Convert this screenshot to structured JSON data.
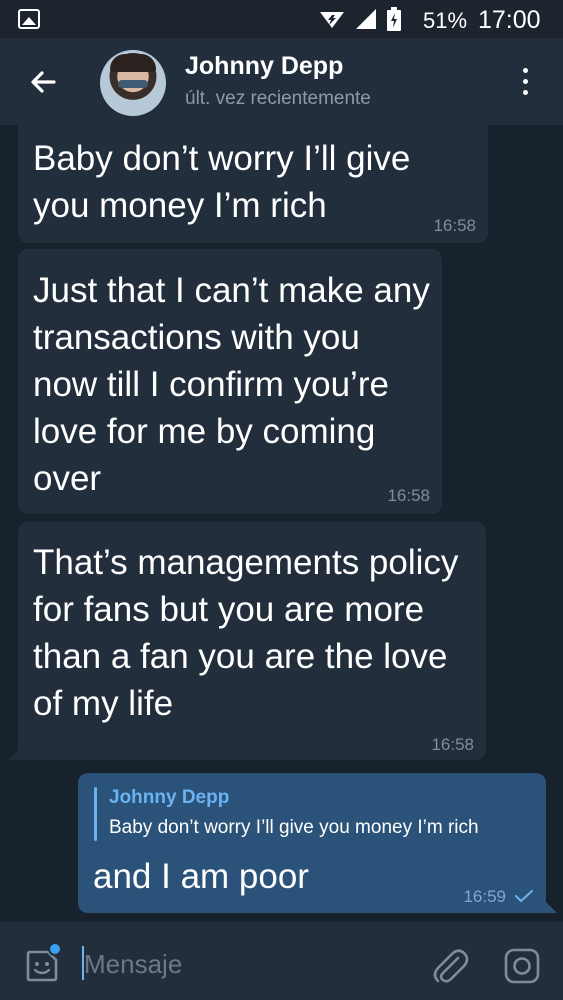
{
  "status_bar": {
    "battery_pct": "51%",
    "time": "17:00"
  },
  "header": {
    "contact_name": "Johnny Depp",
    "last_seen": "últ. vez recientemente"
  },
  "messages": [
    {
      "direction": "incoming",
      "text": "Baby don’t worry I’ll give you money I’m rich",
      "time": "16:58"
    },
    {
      "direction": "incoming",
      "text": "Just that I can’t make any transactions with you now till I confirm you’re love for me by coming over",
      "time": "16:58"
    },
    {
      "direction": "incoming",
      "text": "That’s managements policy for fans but you are more than a fan you are the love of my life",
      "time": "16:58"
    },
    {
      "direction": "outgoing",
      "reply_to": {
        "name": "Johnny Depp",
        "text": "Baby don’t worry I’ll give you money I’m rich"
      },
      "text": "and I am poor",
      "time": "16:59",
      "status": "sent"
    }
  ],
  "composer": {
    "placeholder": "Mensaje"
  },
  "colors": {
    "background": "#18222d",
    "header": "#232e3c",
    "incoming_bubble": "#232e3c",
    "outgoing_bubble": "#2b5278",
    "accent": "#6ab3f3"
  }
}
